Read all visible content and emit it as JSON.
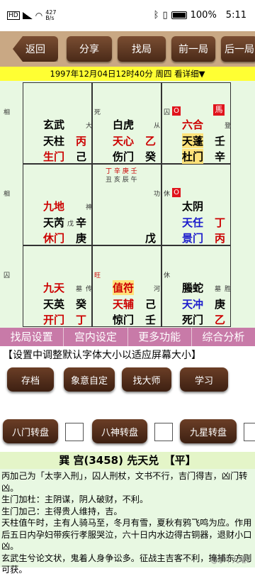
{
  "status": {
    "speed": "427\nB/s",
    "battery": "100%",
    "time": "5:11"
  },
  "nav": {
    "back": "返回",
    "share": "分享",
    "find": "找局",
    "prev": "前一局",
    "next": "后一局"
  },
  "datebar": "1997年12月04日12时40分 周四 看详细▼",
  "cells": {
    "c1": {
      "tag": "相",
      "god": "玄武",
      "god_sm": "大",
      "star": "天柱",
      "star_stem": "丙",
      "door": "生门",
      "door_stem": "己"
    },
    "c2": {
      "tag": "死",
      "god": "白虎",
      "god_sm": "从",
      "star": "天心",
      "star_stem": "乙",
      "door": "伤门",
      "door_stem": "癸"
    },
    "c3": {
      "tag": "囚",
      "zero": "O",
      "horse": "馬",
      "god": "六合",
      "god_sm": "登",
      "star": "天蓬",
      "star_stem": "壬",
      "door": "杜门",
      "door_stem": "辛"
    },
    "c4": {
      "tag": "相",
      "god": "九地",
      "god_sm": "神",
      "star": "天芮",
      "star_stem_sm": "戊",
      "star_stem": "辛",
      "door": "休门",
      "door_stem": "庚"
    },
    "c5": {
      "line1": "丁 辛 庚 壬",
      "line2": "丑 亥 辰 午",
      "tag": "功",
      "center_stem": "戊"
    },
    "c6": {
      "tag": "休",
      "zero": "O",
      "god": "太阴",
      "star": "天任",
      "star_stem": "丁",
      "door": "景门",
      "door_stem": "丙"
    },
    "c7": {
      "tag": "囚",
      "god": "九天",
      "god_sm": "传",
      "god_sm2": "墓",
      "star": "天英",
      "star_stem": "癸",
      "door": "开门",
      "door_stem": "丁"
    },
    "c8": {
      "tag": "旺",
      "god": "值符",
      "god_sm": "河",
      "star": "天辅",
      "star_stem": "己",
      "door": "惊门",
      "door_stem": "壬"
    },
    "c9": {
      "tag": "休",
      "god": "螣蛇",
      "god_sm": "胜",
      "god_sm2": "墓",
      "star": "天冲",
      "star_stem": "庚",
      "door": "死门",
      "door_stem": "乙"
    }
  },
  "funcbar": [
    "找局设置",
    "宫内设定",
    "更多功能",
    "综合分析"
  ],
  "hint": "【设置中调整默认字体大小以适应屏幕大小】",
  "buttons1": [
    "存档",
    "象意自定",
    "找大师",
    "学习"
  ],
  "buttons2": [
    "八门转盘",
    "八神转盘",
    "九星转盘"
  ],
  "info": {
    "title": "巽 宫(3458) 先天兑　【平】",
    "lines": [
      "丙加己为「太孛入刑」，囚人刑杖，文书不行，吉门得吉，凶门转凶。",
      "生门加杜：主阴谋，阴人破财，不利。",
      "生门加己：主得贵人维持，吉。",
      "天柱值午时，主有人骑马至，冬月有雪，夏秋有鸦飞鸣为应。作用后五日内孕妇带疾行孝服哭泣，六十日内水边得古铜器，退财小口凶。",
      "玄武生兮论文状，鬼着人身争讼多。征战主吉客不利，掩捕东方则可获。"
    ],
    "watermark": "@丁午九曜1"
  },
  "colors": {
    "nav_bg": "#c9a884",
    "btn": "#5a3520",
    "date_bg": "#ffff33",
    "board_bg": "#e8f8e2",
    "func_bg": "#c87aa8"
  }
}
